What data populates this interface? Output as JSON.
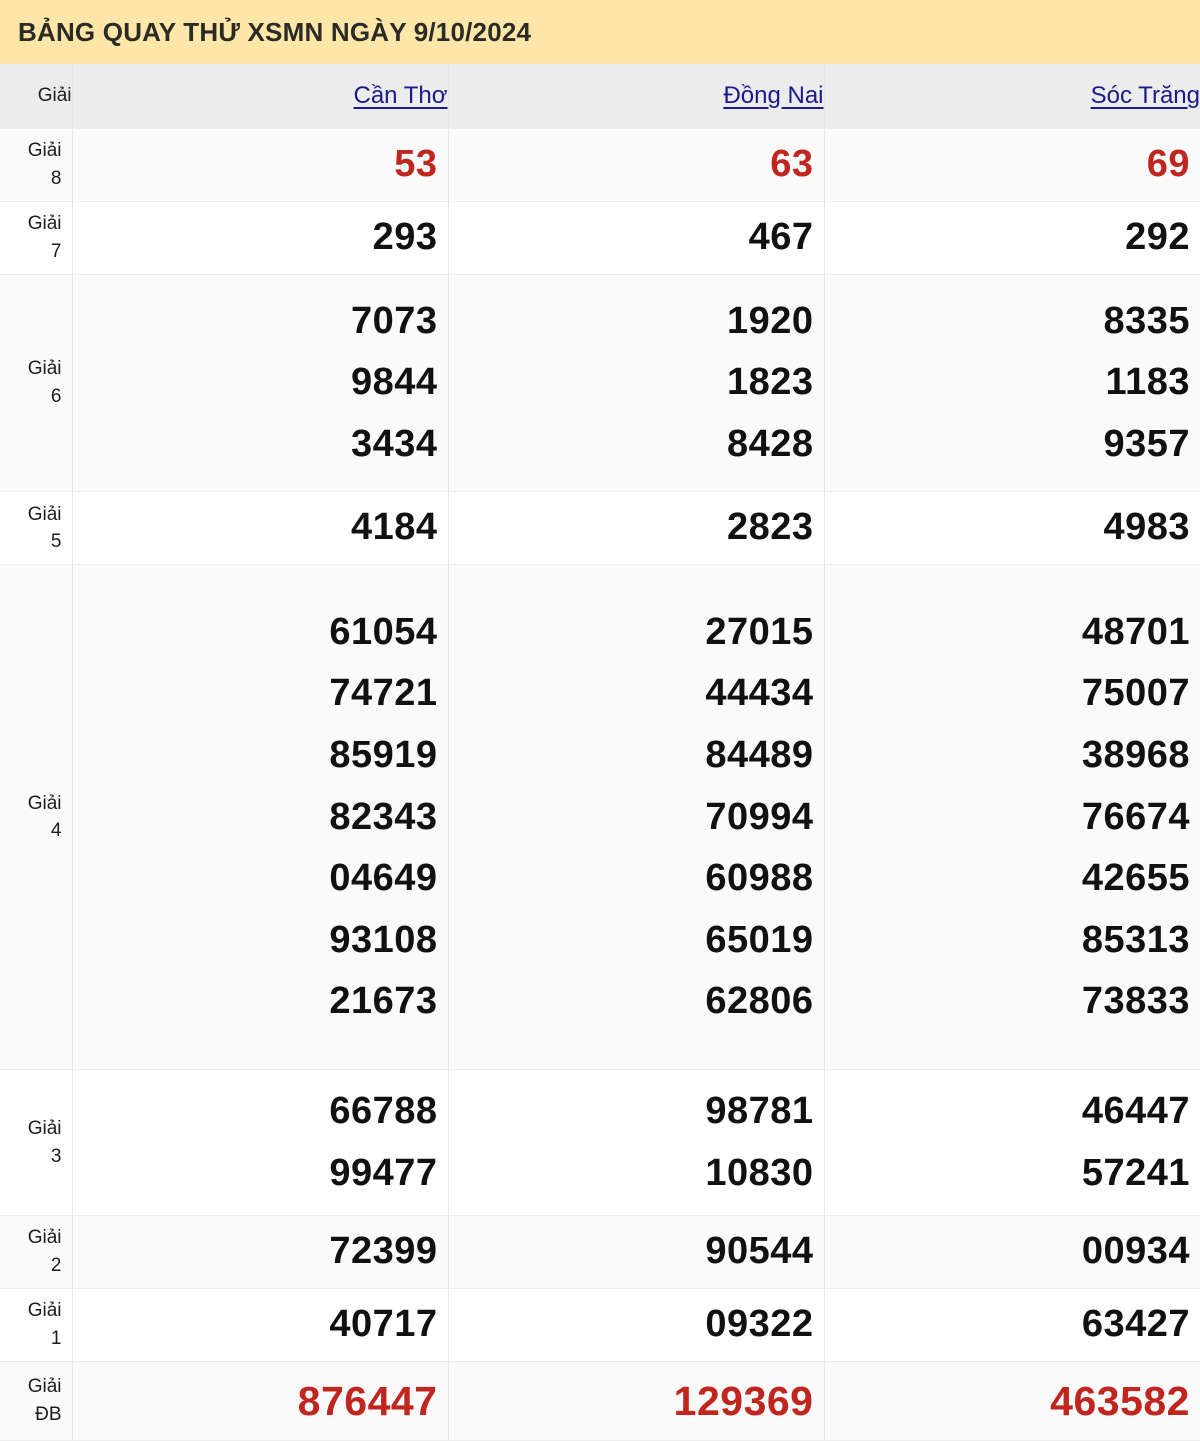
{
  "header": {
    "title": "BẢNG QUAY THỬ XSMN NGÀY 9/10/2024",
    "banner_color": "#fee6a8"
  },
  "table": {
    "label_column_header": "Giải",
    "provinces": [
      "Cần Thơ",
      "Đồng Nai",
      "Sóc Trăng"
    ],
    "colors": {
      "province_link": "#1a1a8c",
      "highlight_number": "#c0261e",
      "normal_number": "#111111",
      "stripe_row": "#fafafa",
      "header_row": "#ececec"
    },
    "rows": [
      {
        "label_word": "Giải",
        "label_num": "8",
        "highlight": true,
        "cells": [
          [
            "53"
          ],
          [
            "63"
          ],
          [
            "69"
          ]
        ]
      },
      {
        "label_word": "Giải",
        "label_num": "7",
        "highlight": false,
        "cells": [
          [
            "293"
          ],
          [
            "467"
          ],
          [
            "292"
          ]
        ]
      },
      {
        "label_word": "Giải",
        "label_num": "6",
        "highlight": false,
        "cells": [
          [
            "7073",
            "9844",
            "3434"
          ],
          [
            "1920",
            "1823",
            "8428"
          ],
          [
            "8335",
            "1183",
            "9357"
          ]
        ]
      },
      {
        "label_word": "Giải",
        "label_num": "5",
        "highlight": false,
        "cells": [
          [
            "4184"
          ],
          [
            "2823"
          ],
          [
            "4983"
          ]
        ]
      },
      {
        "label_word": "Giải",
        "label_num": "4",
        "highlight": false,
        "cells": [
          [
            "61054",
            "74721",
            "85919",
            "82343",
            "04649",
            "93108",
            "21673"
          ],
          [
            "27015",
            "44434",
            "84489",
            "70994",
            "60988",
            "65019",
            "62806"
          ],
          [
            "48701",
            "75007",
            "38968",
            "76674",
            "42655",
            "85313",
            "73833"
          ]
        ]
      },
      {
        "label_word": "Giải",
        "label_num": "3",
        "highlight": false,
        "cells": [
          [
            "66788",
            "99477"
          ],
          [
            "98781",
            "10830"
          ],
          [
            "46447",
            "57241"
          ]
        ]
      },
      {
        "label_word": "Giải",
        "label_num": "2",
        "highlight": false,
        "cells": [
          [
            "72399"
          ],
          [
            "90544"
          ],
          [
            "00934"
          ]
        ]
      },
      {
        "label_word": "Giải",
        "label_num": "1",
        "highlight": false,
        "cells": [
          [
            "40717"
          ],
          [
            "09322"
          ],
          [
            "63427"
          ]
        ]
      },
      {
        "label_word": "Giải",
        "label_num": "ĐB",
        "highlight": true,
        "cells": [
          [
            "876447"
          ],
          [
            "129369"
          ],
          [
            "463582"
          ]
        ]
      }
    ]
  }
}
